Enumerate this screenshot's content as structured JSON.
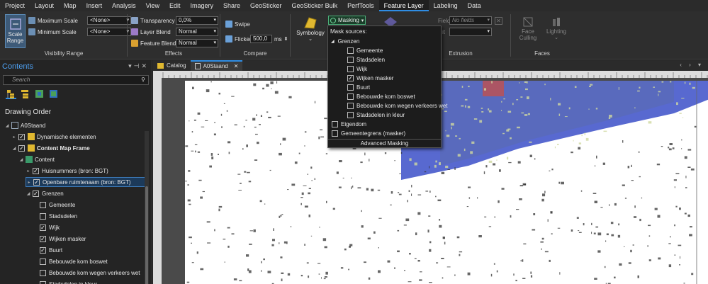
{
  "menu": [
    "Project",
    "Layout",
    "Map",
    "Insert",
    "Analysis",
    "View",
    "Edit",
    "Imagery",
    "Share",
    "GeoSticker",
    "GeoSticker Bulk",
    "PerfTools",
    "Feature Layer",
    "Labeling",
    "Data"
  ],
  "active_menu": "Feature Layer",
  "ribbon": {
    "scale_range": {
      "label1": "Scale",
      "label2": "Range"
    },
    "max_scale": {
      "label": "Maximum Scale",
      "value": "<None>"
    },
    "min_scale": {
      "label": "Minimum Scale",
      "value": "<None>"
    },
    "visibility_group": "Visibility Range",
    "transparency": {
      "label": "Transparency",
      "value": "0,0%"
    },
    "layer_blend": {
      "label": "Layer Blend",
      "value": "Normal"
    },
    "feature_blend": {
      "label": "Feature Blend",
      "value": "Normal"
    },
    "effects_group": "Effects",
    "swipe": "Swipe",
    "flicker": {
      "label": "Flicker",
      "value": "500,0",
      "unit": "ms"
    },
    "compare_group": "Compare",
    "symbology": "Symbology",
    "masking": "Masking",
    "field": {
      "label": "Field",
      "value": "No fields"
    },
    "unit_label": "it",
    "extrusion_group": "Extrusion",
    "face_culling": {
      "label1": "Face",
      "label2": "Culling"
    },
    "lighting": "Lighting",
    "faces_group": "Faces"
  },
  "mask_dropdown": {
    "header": "Mask sources:",
    "group": "Grenzen",
    "items": [
      {
        "label": "Gemeente",
        "checked": false
      },
      {
        "label": "Stadsdelen",
        "checked": false
      },
      {
        "label": "Wijk",
        "checked": false
      },
      {
        "label": "Wijken masker",
        "checked": true
      },
      {
        "label": "Buurt",
        "checked": false
      },
      {
        "label": "Bebouwde kom boswet",
        "checked": false
      },
      {
        "label": "Bebouwde kom wegen verkeers wet",
        "checked": false
      },
      {
        "label": "Stadsdelen in kleur",
        "checked": false
      }
    ],
    "others": [
      {
        "label": "Eigendom",
        "checked": false
      },
      {
        "label": "Gemeentegrens (masker)",
        "checked": false
      }
    ],
    "advanced": "Advanced Masking"
  },
  "contents": {
    "title": "Contents",
    "search_placeholder": "Search",
    "drawing_order": "Drawing Order",
    "tree": [
      {
        "label": "A0Staand",
        "level": 0,
        "checkbox": false,
        "bold": false
      },
      {
        "label": "Dynamische elementen",
        "level": 1,
        "checkbox": true,
        "checked": true,
        "bold": false
      },
      {
        "label": "Content Map Frame",
        "level": 1,
        "checkbox": true,
        "checked": true,
        "bold": true
      },
      {
        "label": "Content",
        "level": 2,
        "checkbox": false,
        "bold": false
      },
      {
        "label": "Huisnummers (bron: BGT)",
        "level": 3,
        "checkbox": true,
        "checked": true,
        "bold": false
      },
      {
        "label": "Openbare ruimtenaam (bron: BGT)",
        "level": 3,
        "checkbox": true,
        "checked": true,
        "bold": false,
        "highlight": true
      },
      {
        "label": "Grenzen",
        "level": 3,
        "checkbox": true,
        "checked": true,
        "bold": false
      },
      {
        "label": "Gemeente",
        "level": 4,
        "checkbox": true,
        "checked": false,
        "bold": false
      },
      {
        "label": "Stadsdelen",
        "level": 4,
        "checkbox": true,
        "checked": false,
        "bold": false
      },
      {
        "label": "Wijk",
        "level": 4,
        "checkbox": true,
        "checked": true,
        "bold": false
      },
      {
        "label": "Wijken masker",
        "level": 4,
        "checkbox": true,
        "checked": true,
        "bold": false
      },
      {
        "label": "Buurt",
        "level": 4,
        "checkbox": true,
        "checked": true,
        "bold": false
      },
      {
        "label": "Bebouwde kom boswet",
        "level": 4,
        "checkbox": true,
        "checked": false,
        "bold": false
      },
      {
        "label": "Bebouwde kom wegen verkeers wet",
        "level": 4,
        "checkbox": true,
        "checked": false,
        "bold": false
      },
      {
        "label": "Stadsdelen in kleur",
        "level": 4,
        "checkbox": true,
        "checked": false,
        "bold": false
      }
    ]
  },
  "tabs": [
    {
      "label": "Catalog",
      "active": false
    },
    {
      "label": "A0Staand",
      "active": true
    }
  ],
  "colors": {
    "accent": "#2f8de4",
    "mask_overlay": "#3b4fc8"
  }
}
